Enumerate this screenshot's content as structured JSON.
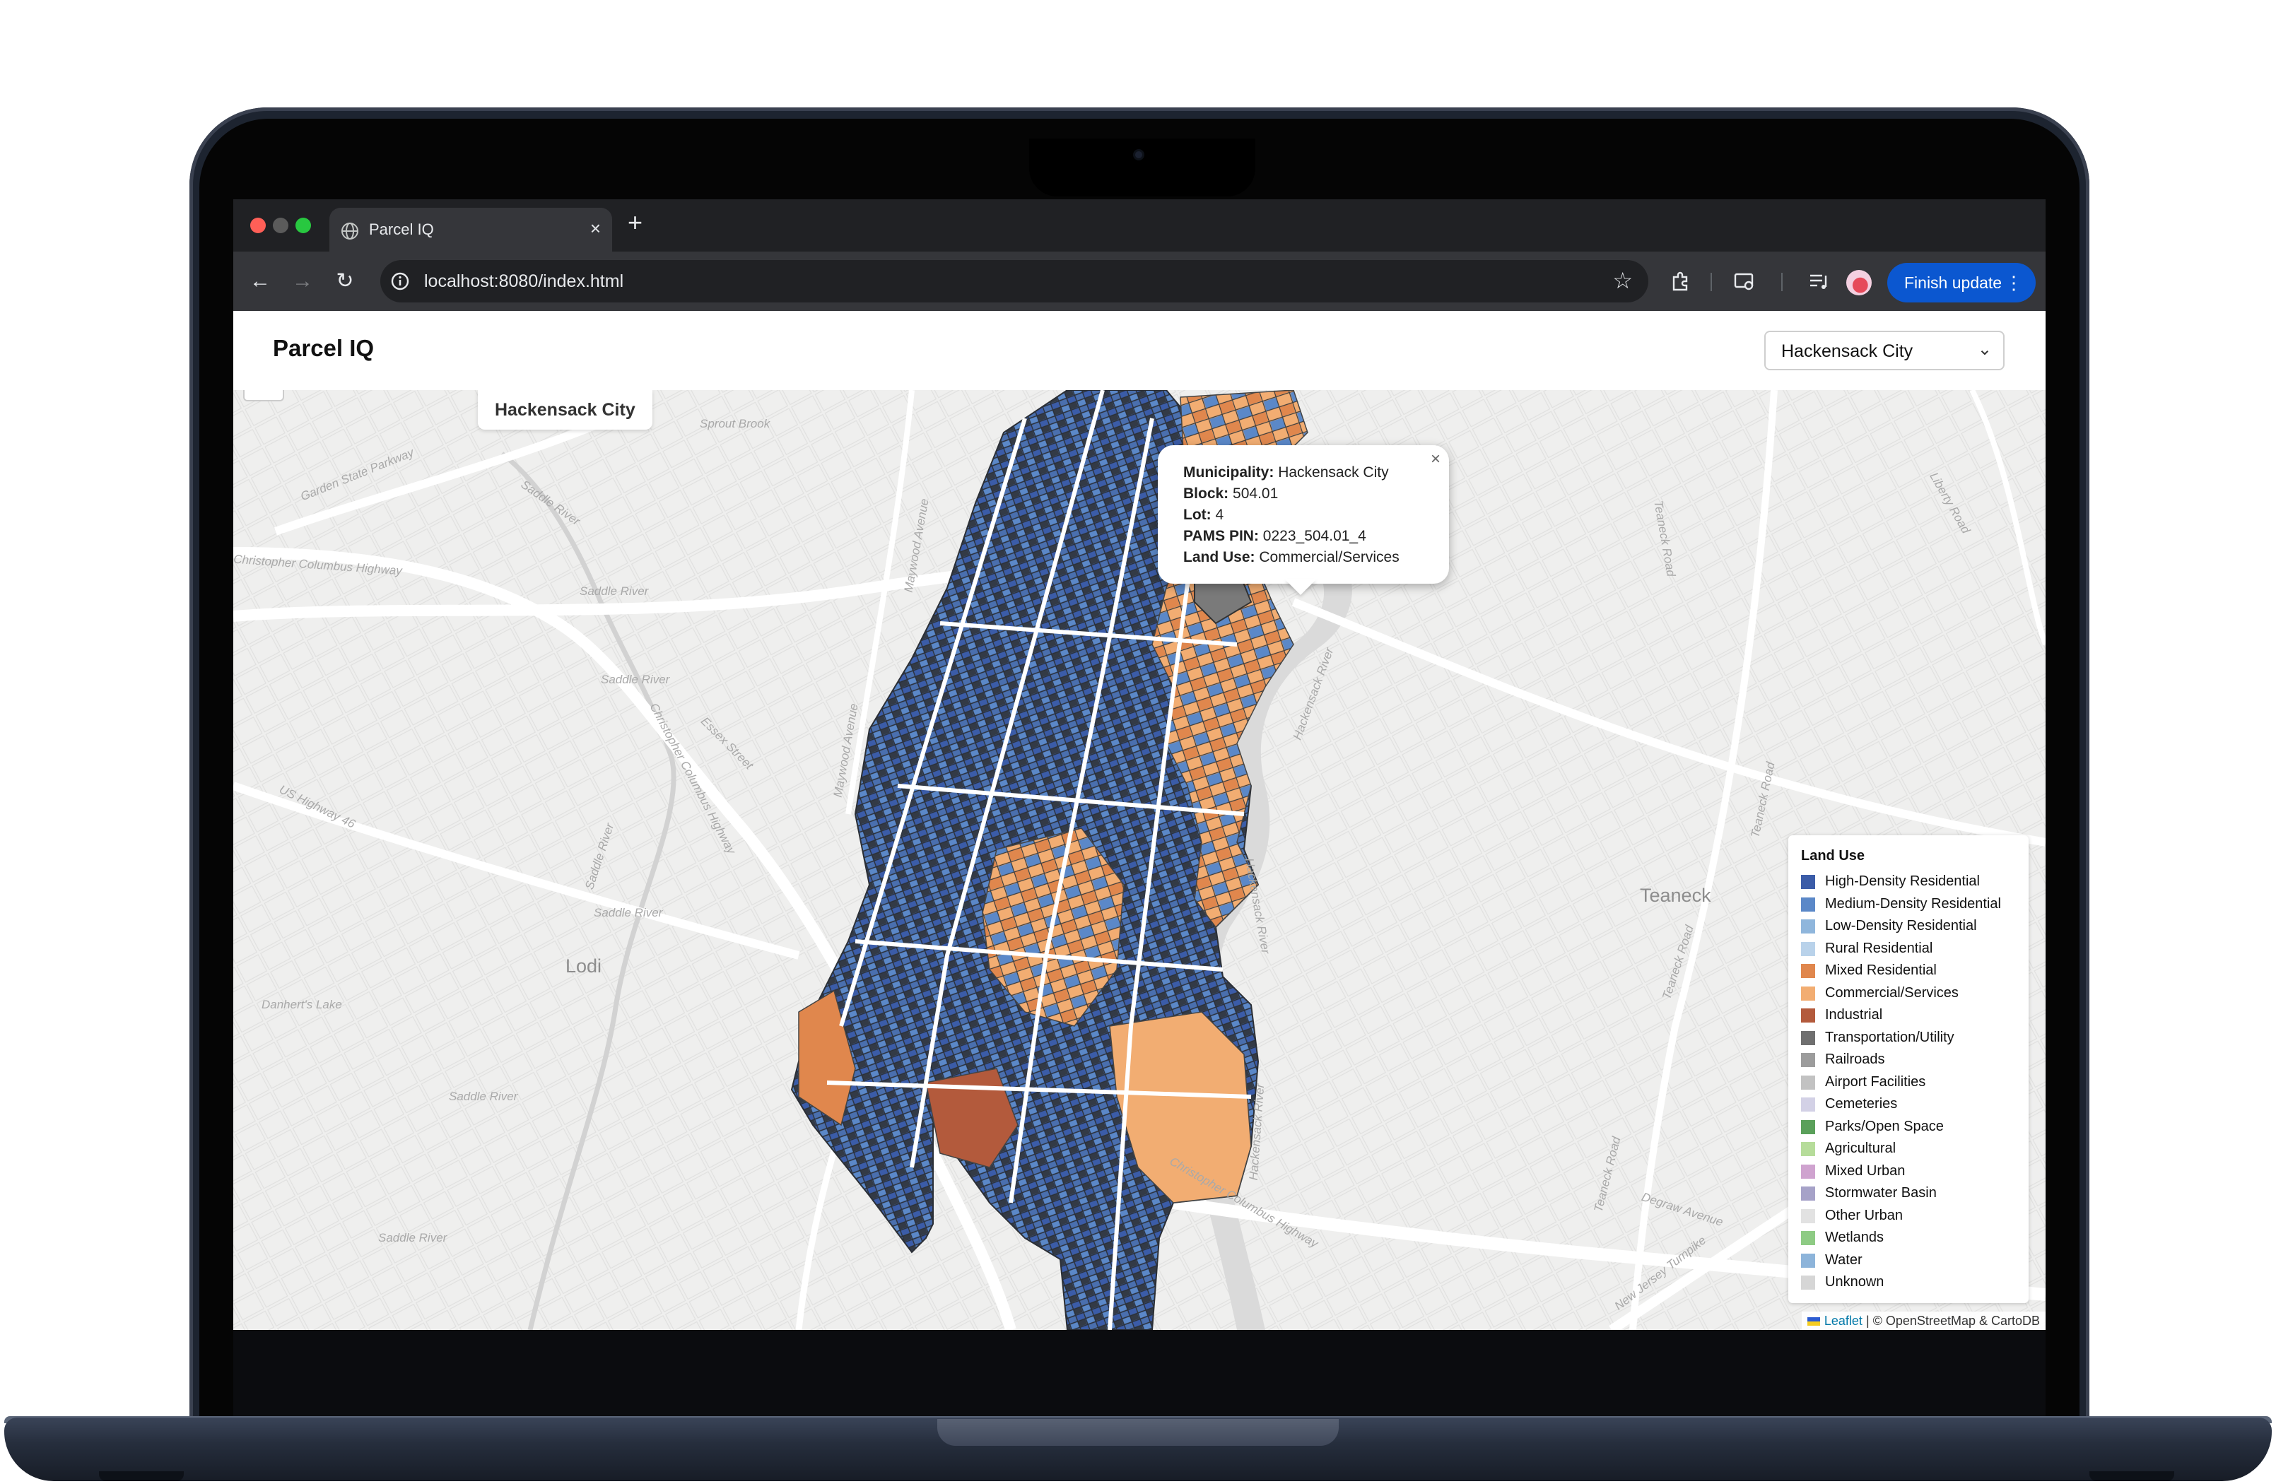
{
  "browser": {
    "tab_title": "Parcel IQ",
    "url": "localhost:8080/index.html",
    "finish_update_label": "Finish update",
    "icons": [
      "back-icon",
      "forward-icon",
      "reload-icon",
      "site-info-icon",
      "bookmark-star-icon",
      "extensions-icon",
      "cast-icon",
      "media-controls-icon",
      "profile-avatar",
      "kebab-menu-icon"
    ]
  },
  "app": {
    "title": "Parcel IQ",
    "municipality_select": {
      "selected": "Hackensack City"
    }
  },
  "map": {
    "municipality_label": "Hackensack City",
    "place_labels": {
      "lodi": "Lodi",
      "teaneck": "Teaneck",
      "garden_state": "Garden State Parkway",
      "saddle_river_1": "Saddle River",
      "saddle_river_2": "Saddle River",
      "saddle_river_3": "Saddle River",
      "saddle_river_4": "Saddle River",
      "saddle_river_5": "Saddle River",
      "saddle_river_6": "Saddle River",
      "saddle_river_7": "Saddle River",
      "sprout_brook": "Sprout Brook",
      "columbus_hwy_1": "Christopher Columbus Highway",
      "columbus_hwy_2": "Christopher Columbus Highway",
      "columbus_hwy_3": "Christopher Columbus Highway",
      "maywood_1": "Maywood Avenue",
      "maywood_2": "Maywood Avenue",
      "essex": "Essex Street",
      "us46": "US Highway 46",
      "danherts": "Danhert's Lake",
      "teaneck_road_1": "Teaneck Road",
      "teaneck_road_2": "Teaneck Road",
      "teaneck_road_3": "Teaneck Road",
      "teaneck_road_4": "Teaneck Road",
      "liberty": "Liberty Road",
      "degraw": "Degraw Avenue",
      "nj_turnpike": "New Jersey Turnpike",
      "hackensack_river_1": "Hackensack River",
      "hackensack_river_2": "Hackensack River",
      "hackensack_river_3": "Hackensack River"
    },
    "popup": {
      "municipality_label": "Municipality:",
      "municipality": "Hackensack City",
      "block_label": "Block:",
      "block": "504.01",
      "lot_label": "Lot:",
      "lot": "4",
      "pams_label": "PAMS PIN:",
      "pams": "0223_504.01_4",
      "landuse_label": "Land Use:",
      "landuse": "Commercial/Services"
    },
    "legend": {
      "title": "Land Use",
      "items": [
        {
          "label": "High-Density Residential",
          "color": "#3b5ca8"
        },
        {
          "label": "Medium-Density Residential",
          "color": "#5b88c8"
        },
        {
          "label": "Low-Density Residential",
          "color": "#8fb6dc"
        },
        {
          "label": "Rural Residential",
          "color": "#b9d2ea"
        },
        {
          "label": "Mixed Residential",
          "color": "#e0874d"
        },
        {
          "label": "Commercial/Services",
          "color": "#f2ad72"
        },
        {
          "label": "Industrial",
          "color": "#b35a3c"
        },
        {
          "label": "Transportation/Utility",
          "color": "#6f6f6f"
        },
        {
          "label": "Railroads",
          "color": "#9c9c9c"
        },
        {
          "label": "Airport Facilities",
          "color": "#c2c2c2"
        },
        {
          "label": "Cemeteries",
          "color": "#d3d1e6"
        },
        {
          "label": "Parks/Open Space",
          "color": "#5aa05a"
        },
        {
          "label": "Agricultural",
          "color": "#b6dc9a"
        },
        {
          "label": "Mixed Urban",
          "color": "#cfa3cf"
        },
        {
          "label": "Stormwater Basin",
          "color": "#a6a2c8"
        },
        {
          "label": "Other Urban",
          "color": "#e2e2e2"
        },
        {
          "label": "Wetlands",
          "color": "#8ecb84"
        },
        {
          "label": "Water",
          "color": "#8db4da"
        },
        {
          "label": "Unknown",
          "color": "#d6d6d6"
        }
      ]
    },
    "attribution": {
      "leaflet": "Leaflet",
      "rest": "| © OpenStreetMap & CartoDB"
    }
  }
}
